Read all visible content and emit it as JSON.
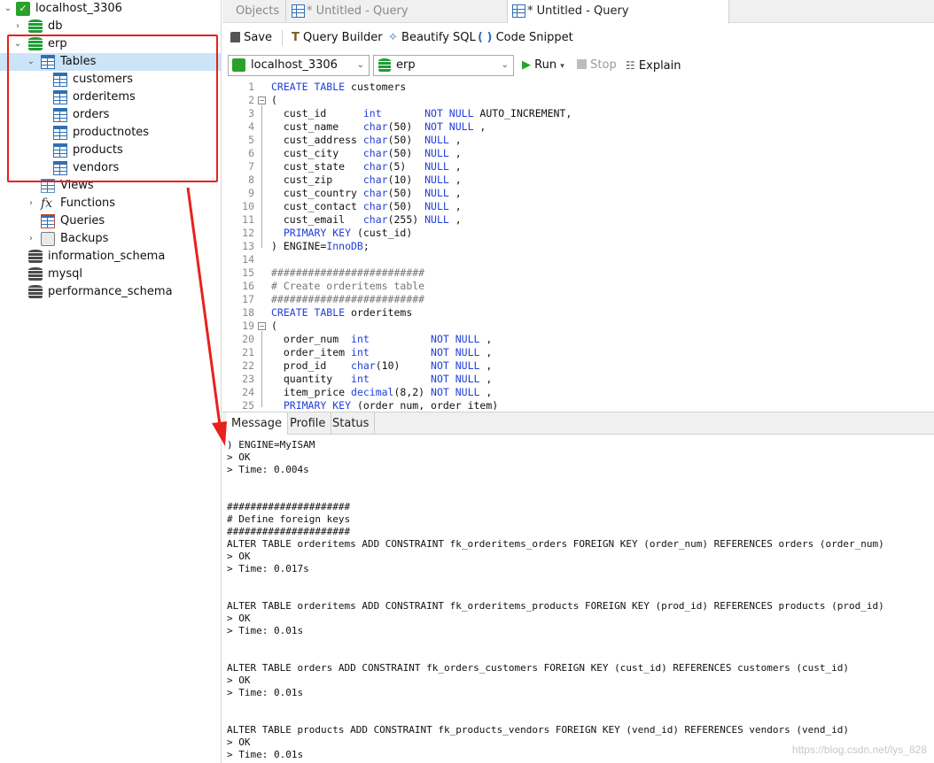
{
  "sidebar": {
    "connection": "localhost_3306",
    "databases": [
      "db",
      "erp"
    ],
    "tables_label": "Tables",
    "tables": [
      "customers",
      "orderitems",
      "orders",
      "productnotes",
      "products",
      "vendors"
    ],
    "views_label": "Views",
    "functions_label": "Functions",
    "queries_label": "Queries",
    "backups_label": "Backups",
    "other_databases": [
      "information_schema",
      "mysql",
      "performance_schema"
    ]
  },
  "tabs": [
    {
      "label": "Objects"
    },
    {
      "label": "* Untitled - Query"
    },
    {
      "label": "* Untitled - Query"
    }
  ],
  "toolbar": {
    "save": "Save",
    "query_builder": "Query Builder",
    "beautify": "Beautify SQL",
    "snippet": "Code Snippet",
    "connection_select": "localhost_3306",
    "database_select": "erp",
    "run": "Run",
    "stop": "Stop",
    "explain": "Explain"
  },
  "editor": {
    "line_numbers": [
      "1",
      "2",
      "3",
      "4",
      "5",
      "6",
      "7",
      "8",
      "9",
      "10",
      "11",
      "12",
      "13",
      "14",
      "15",
      "16",
      "17",
      "18",
      "19",
      "20",
      "21",
      "22",
      "23",
      "24",
      "25"
    ]
  },
  "message_tabs": [
    "Message",
    "Profile",
    "Status"
  ],
  "messages": [
    ") ENGINE=MyISAM",
    "> OK",
    "> Time: 0.004s",
    "",
    "",
    "#####################",
    "# Define foreign keys",
    "#####################",
    "ALTER TABLE orderitems ADD CONSTRAINT fk_orderitems_orders FOREIGN KEY (order_num) REFERENCES orders (order_num)",
    "> OK",
    "> Time: 0.017s",
    "",
    "",
    "ALTER TABLE orderitems ADD CONSTRAINT fk_orderitems_products FOREIGN KEY (prod_id) REFERENCES products (prod_id)",
    "> OK",
    "> Time: 0.01s",
    "",
    "",
    "ALTER TABLE orders ADD CONSTRAINT fk_orders_customers FOREIGN KEY (cust_id) REFERENCES customers (cust_id)",
    "> OK",
    "> Time: 0.01s",
    "",
    "",
    "ALTER TABLE products ADD CONSTRAINT fk_products_vendors FOREIGN KEY (vend_id) REFERENCES vendors (vend_id)",
    "> OK",
    "> Time: 0.01s"
  ],
  "watermark": "https://blog.csdn.net/lys_828",
  "colors": {
    "annotation": "#e8211d",
    "keyword": "#1f3fd8",
    "selection": "#cce4f7"
  }
}
